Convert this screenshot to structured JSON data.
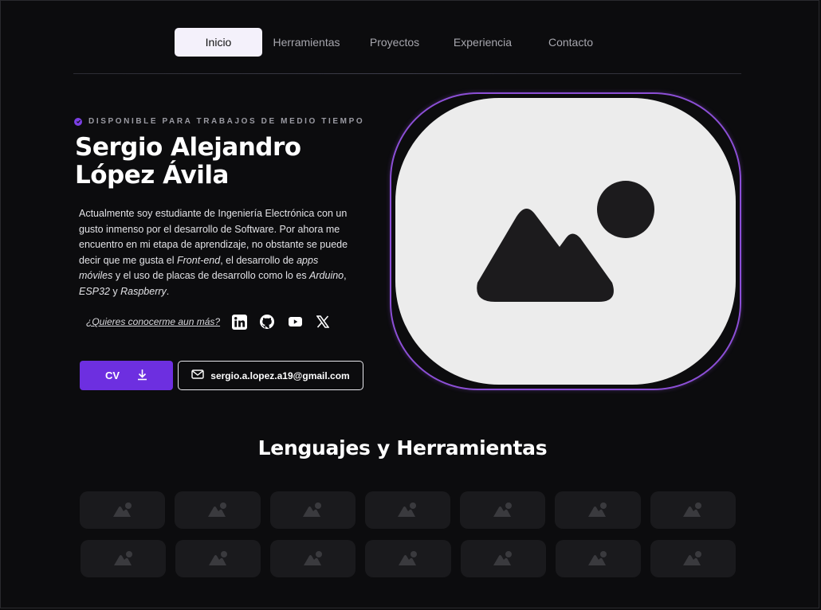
{
  "nav": {
    "items": [
      {
        "label": "Inicio",
        "active": true
      },
      {
        "label": "Herramientas",
        "active": false
      },
      {
        "label": "Proyectos",
        "active": false
      },
      {
        "label": "Experiencia",
        "active": false
      },
      {
        "label": "Contacto",
        "active": false
      }
    ]
  },
  "hero": {
    "availability": "DISPONIBLE PARA TRABAJOS DE MEDIO TIEMPO",
    "name": "Sergio Alejandro López Ávila",
    "bio": {
      "p1": "Actualmente soy estudiante de Ingeniería Electrónica con un gusto inmenso por el desarrollo de Software. Por ahora me encuentro en mi etapa de aprendizaje, no obstante se puede decir que me gusta el ",
      "front": "Front-end",
      "p2": ", el desarrollo de ",
      "apps": "apps móviles",
      "p3": " y el uso de placas de desarrollo como lo es ",
      "arduino": "Arduino",
      "p4": ", ",
      "esp": "ESP32",
      "p5": " y ",
      "rasp": "Raspberry",
      "p6": "."
    },
    "more_link": "¿Quieres conocerme aun más?",
    "social_icons": [
      "linkedin-icon",
      "github-icon",
      "youtube-icon",
      "x-icon"
    ],
    "cv_label": "CV",
    "email": "sergio.a.lopez.a19@gmail.com",
    "accent": "#6d2fe0"
  },
  "skills": {
    "title": "Lenguajes y Herramientas",
    "rows": [
      7,
      7
    ]
  }
}
